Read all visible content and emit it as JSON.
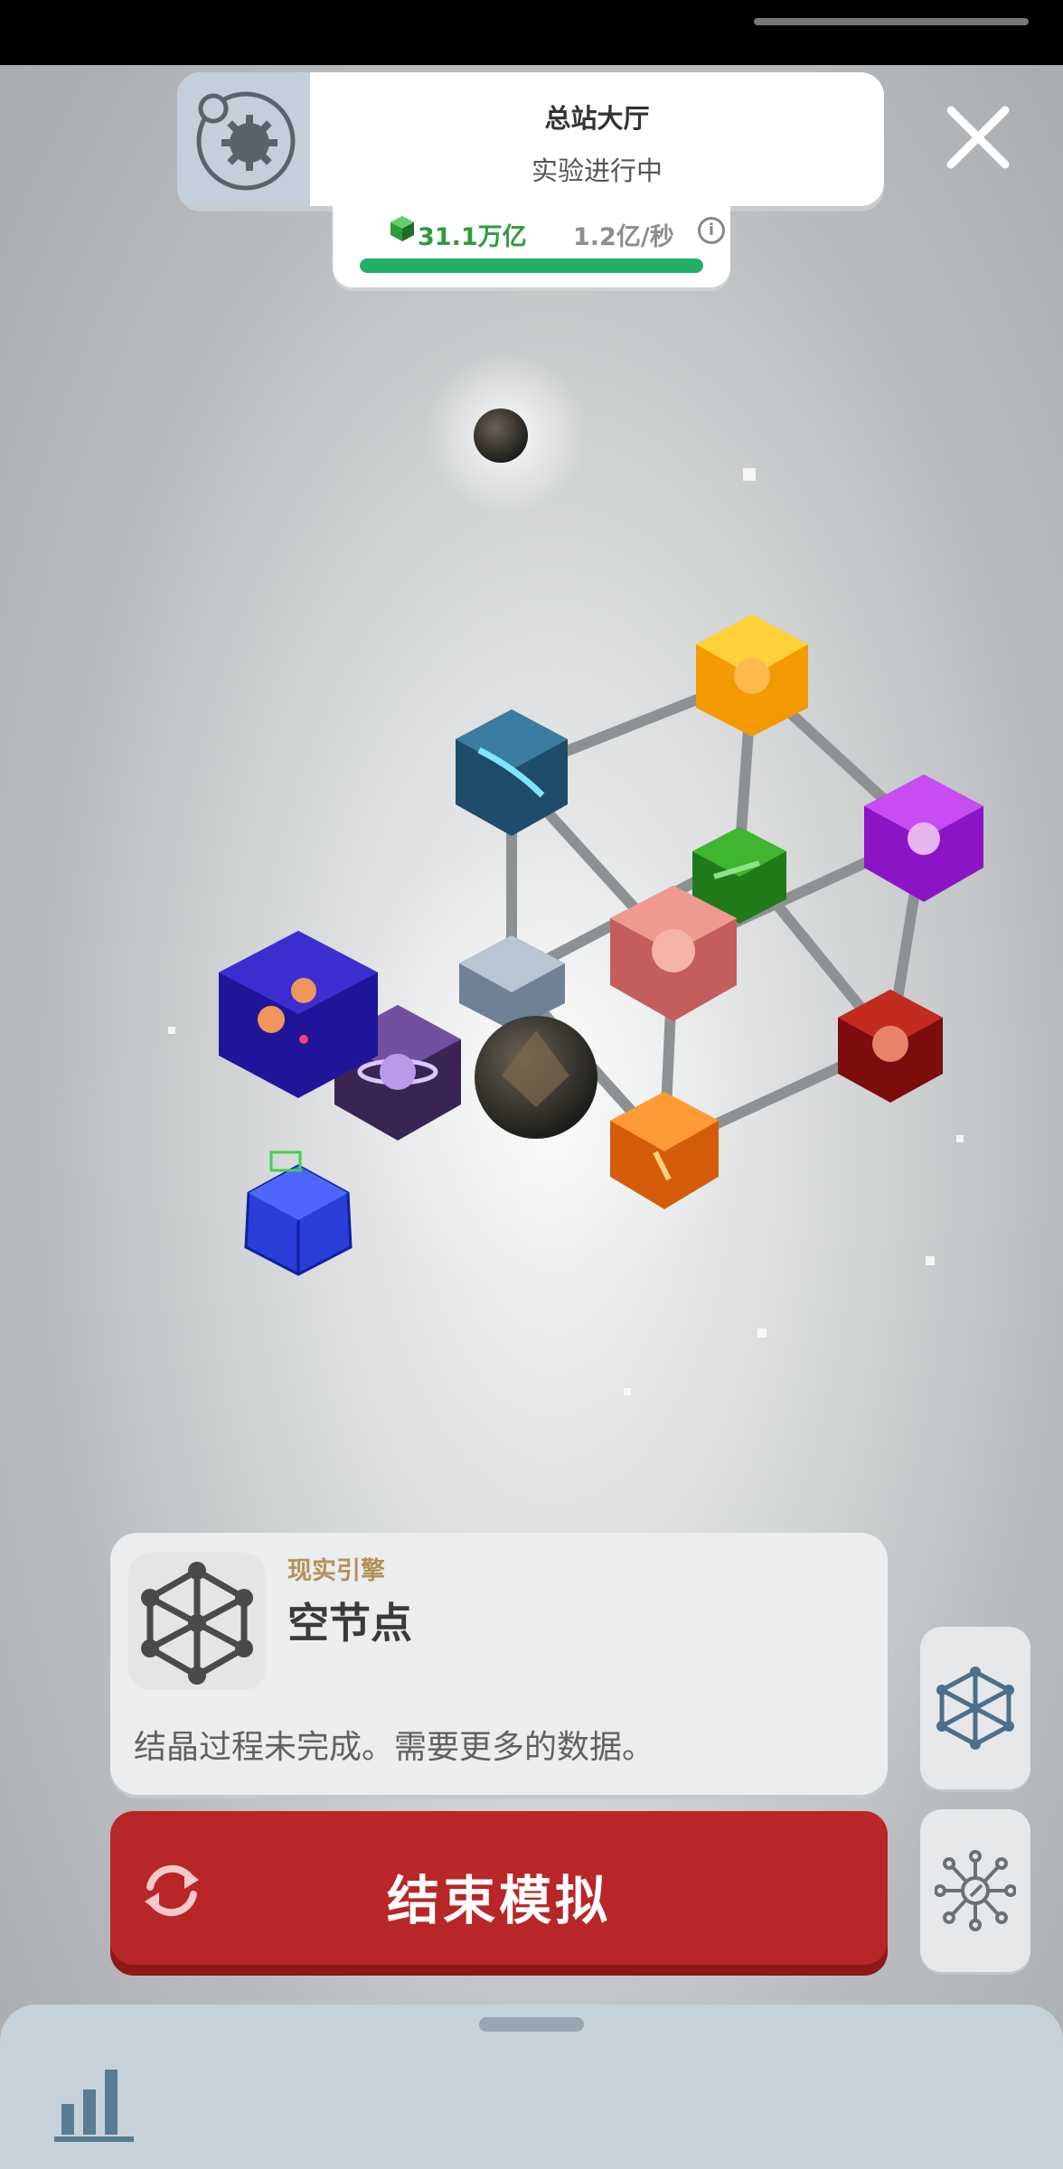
{
  "header": {
    "title": "总站大厅",
    "subtitle": "实验进行中"
  },
  "resources": {
    "amount": "31.1万亿",
    "rate": "1.2亿/秒",
    "progress": 1.0
  },
  "info_card": {
    "category": "现实引擎",
    "name": "空节点",
    "description": "结晶过程未完成。需要更多的数据。"
  },
  "end_button": {
    "label": "结束模拟"
  },
  "icons": {
    "hub": "gear-planet-icon",
    "close": "close-icon",
    "gem": "gem-icon",
    "info": "info-icon",
    "node": "crystal-node-icon",
    "refresh": "refresh-icon",
    "network": "network-icon",
    "tree": "node-tree-icon",
    "stats": "bar-chart-icon"
  },
  "colors": {
    "accent_red": "#b92627",
    "progress_green": "#22b067",
    "category_gold": "#b1935a"
  }
}
